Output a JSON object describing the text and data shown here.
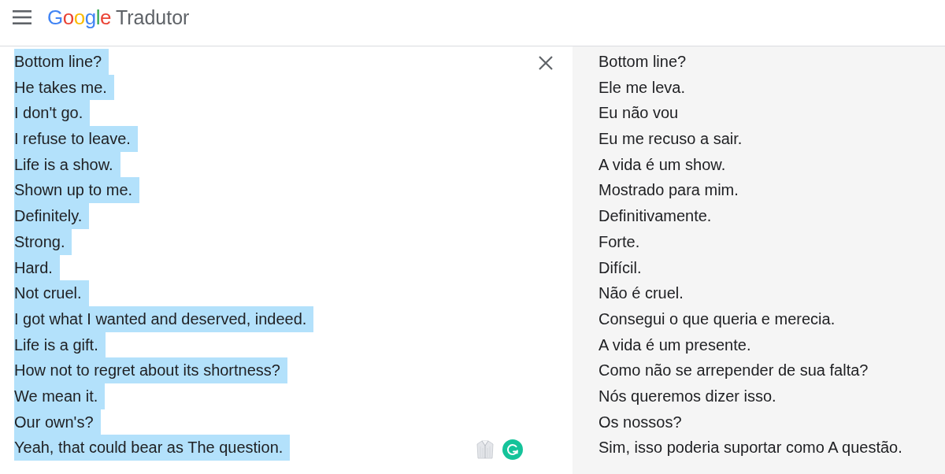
{
  "header": {
    "logo": "Google",
    "app_name": "Tradutor"
  },
  "source": {
    "lines": [
      {
        "text": "Bottom line?",
        "selected": true
      },
      {
        "text": "He takes me.",
        "selected": true
      },
      {
        "text": "I don't go.",
        "selected": true
      },
      {
        "text": "I refuse to leave.",
        "selected": true
      },
      {
        "text": "Life is a show.",
        "selected": true
      },
      {
        "text": "Shown up to me.",
        "selected": true
      },
      {
        "text": "Definitely.",
        "selected": true
      },
      {
        "text": "Strong.",
        "selected": true
      },
      {
        "text": "Hard.",
        "selected": true
      },
      {
        "text": "Not cruel.",
        "selected": true
      },
      {
        "text": "I got what I wanted and deserved, indeed.",
        "selected": true
      },
      {
        "text": "Life is a gift.",
        "selected": true
      },
      {
        "text": "How not to regret about its shortness?",
        "selected": true
      },
      {
        "text": "We mean it.",
        "selected": true
      },
      {
        "text": "Our own's?",
        "selected": true
      },
      {
        "text": "Yeah, that could bear as The question.",
        "selected": true
      }
    ]
  },
  "translation": {
    "lines": [
      "Bottom line?",
      "Ele me leva.",
      "Eu não vou",
      "Eu me recuso a sair.",
      "A vida é um show.",
      "Mostrado para mim.",
      "Definitivamente.",
      "Forte.",
      "Difícil.",
      "Não é cruel.",
      "Consegui o que queria e merecia.",
      "A vida é um presente.",
      "Como não se arrepender de sua falta?",
      "Nós queremos dizer isso.",
      "Os nossos?",
      "Sim, isso poderia suportar como A questão."
    ]
  }
}
